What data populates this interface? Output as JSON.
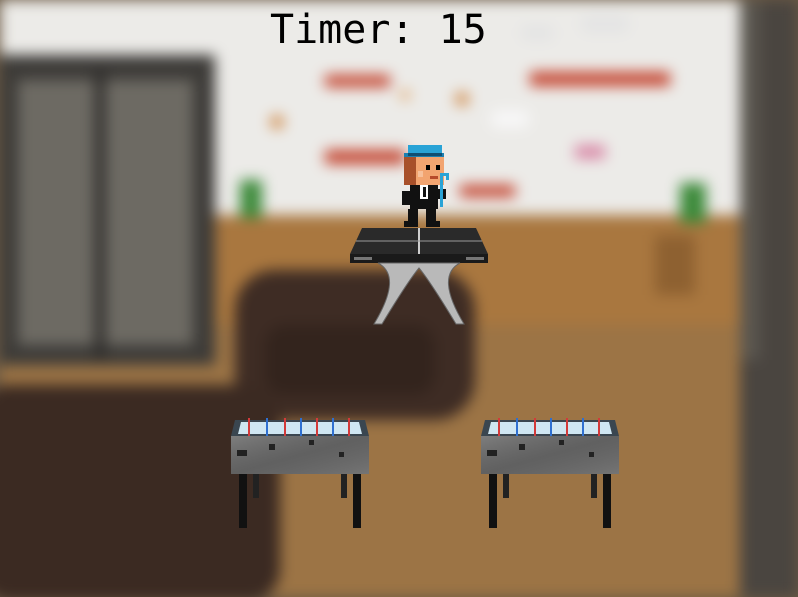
{
  "hud": {
    "timer_label": "Timer:",
    "timer_value": "15"
  },
  "sprites": {
    "player": "pixel-character-blue-hat",
    "platforms": [
      "ping-pong-table",
      "foosball-table",
      "foosball-table"
    ]
  },
  "colors": {
    "timer_text": "#000000",
    "hat": "#29a3d6",
    "suit": "#111111",
    "foosball_red": "#d23a3a",
    "foosball_blue": "#2e6fd0"
  }
}
